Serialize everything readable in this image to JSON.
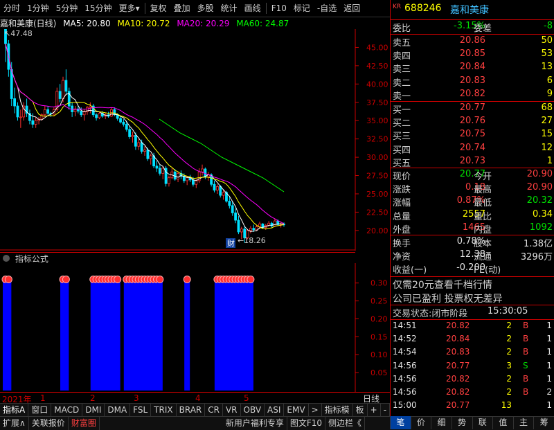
{
  "toolbar": {
    "items": [
      "分时",
      "1分钟",
      "5分钟",
      "15分钟",
      "更多▾",
      "复权",
      "叠加",
      "多股",
      "统计",
      "画线",
      "F10",
      "标记",
      "-自选",
      "返回"
    ]
  },
  "chart_header": {
    "name": "嘉和美康(日线)",
    "ma5": "MA5: 20.80",
    "ma10": "MA10: 20.72",
    "ma20": "MA20: 20.29",
    "ma60": "MA60: 24.87",
    "high_label": "47.48",
    "low_label": "18.26",
    "cai_label": "财"
  },
  "colors": {
    "ma5": "#ffffff",
    "ma10": "#ffff00",
    "ma20": "#ff00ff",
    "ma60": "#00ff00",
    "axis": "#cc0000"
  },
  "indicator": {
    "title": "指标公式"
  },
  "chart_data": [
    {
      "type": "candlestick",
      "title": "嘉和美康(日线)",
      "y_ticks": [
        45.0,
        42.5,
        40.0,
        37.5,
        35.0,
        32.5,
        30.0,
        27.5,
        25.0,
        22.5,
        20.0
      ],
      "ylim": [
        18.0,
        47.5
      ],
      "series": [
        {
          "name": "MA5",
          "values": []
        },
        {
          "name": "MA10",
          "values": []
        },
        {
          "name": "MA20",
          "values": []
        },
        {
          "name": "MA60",
          "values": []
        }
      ],
      "ohlc": [
        [
          47.5,
          47.5,
          43.0,
          45.5
        ],
        [
          45.5,
          46.0,
          41.0,
          42.0
        ],
        [
          42.0,
          43.0,
          37.0,
          38.0
        ],
        [
          38.0,
          39.5,
          36.0,
          37.0
        ],
        [
          37.0,
          37.5,
          35.0,
          35.5
        ],
        [
          35.5,
          36.5,
          34.0,
          35.5
        ],
        [
          35.5,
          37.5,
          35.0,
          37.0
        ],
        [
          37.0,
          38.0,
          35.5,
          36.0
        ],
        [
          36.0,
          36.5,
          34.5,
          35.0
        ],
        [
          35.0,
          36.0,
          34.0,
          34.5
        ],
        [
          34.5,
          35.5,
          34.0,
          35.0
        ],
        [
          35.0,
          35.5,
          34.5,
          35.2
        ],
        [
          35.2,
          36.0,
          35.0,
          35.8
        ],
        [
          35.8,
          37.0,
          35.5,
          36.5
        ],
        [
          36.5,
          37.0,
          35.8,
          36.0
        ],
        [
          36.0,
          36.2,
          35.5,
          35.9
        ],
        [
          35.9,
          36.8,
          35.7,
          36.5
        ],
        [
          36.5,
          39.5,
          36.2,
          39.0
        ],
        [
          39.0,
          40.0,
          37.5,
          38.0
        ],
        [
          38.0,
          41.0,
          37.5,
          40.5
        ],
        [
          40.5,
          42.0,
          38.5,
          39.0
        ],
        [
          39.0,
          39.5,
          36.5,
          37.0
        ],
        [
          37.0,
          37.5,
          35.5,
          36.2
        ],
        [
          36.2,
          37.0,
          35.6,
          36.6
        ],
        [
          36.6,
          37.0,
          36.0,
          36.3
        ],
        [
          36.3,
          36.8,
          35.5,
          35.8
        ],
        [
          35.8,
          36.5,
          35.0,
          36.2
        ],
        [
          36.2,
          37.0,
          35.8,
          36.8
        ],
        [
          36.8,
          37.5,
          36.0,
          37.0
        ],
        [
          37.0,
          37.3,
          35.5,
          35.8
        ],
        [
          35.8,
          36.0,
          35.0,
          35.4
        ],
        [
          35.4,
          36.2,
          35.2,
          36.0
        ],
        [
          36.0,
          36.3,
          35.4,
          35.6
        ],
        [
          35.6,
          36.0,
          35.2,
          35.8
        ],
        [
          35.8,
          36.2,
          35.4,
          35.6
        ],
        [
          35.6,
          36.8,
          35.5,
          36.5
        ],
        [
          36.5,
          36.8,
          35.6,
          35.8
        ],
        [
          35.8,
          36.0,
          35.0,
          35.3
        ],
        [
          35.3,
          35.6,
          34.6,
          34.8
        ],
        [
          34.8,
          35.2,
          34.2,
          34.5
        ],
        [
          34.5,
          35.0,
          33.5,
          33.8
        ],
        [
          33.8,
          34.2,
          32.5,
          32.8
        ],
        [
          32.8,
          33.5,
          32.0,
          33.0
        ],
        [
          33.0,
          33.4,
          31.0,
          31.5
        ],
        [
          31.5,
          32.5,
          31.0,
          32.0
        ],
        [
          32.0,
          32.4,
          30.5,
          30.8
        ],
        [
          30.8,
          31.5,
          30.2,
          31.0
        ],
        [
          31.0,
          31.3,
          29.5,
          29.8
        ],
        [
          29.8,
          30.5,
          29.0,
          30.2
        ],
        [
          30.2,
          30.6,
          28.5,
          28.8
        ],
        [
          28.8,
          29.5,
          28.0,
          28.5
        ],
        [
          28.5,
          29.0,
          27.5,
          27.8
        ],
        [
          27.8,
          28.8,
          27.0,
          28.5
        ],
        [
          28.5,
          28.8,
          26.0,
          26.4
        ],
        [
          26.4,
          27.5,
          26.0,
          27.2
        ],
        [
          27.2,
          28.5,
          27.0,
          28.0
        ],
        [
          28.0,
          28.4,
          26.8,
          27.0
        ],
        [
          27.0,
          28.0,
          26.6,
          27.8
        ],
        [
          27.8,
          28.2,
          27.0,
          27.4
        ],
        [
          27.4,
          27.8,
          26.5,
          26.8
        ],
        [
          26.8,
          27.4,
          26.2,
          27.2
        ],
        [
          27.2,
          27.6,
          26.6,
          26.9
        ],
        [
          26.9,
          27.3,
          26.0,
          26.3
        ],
        [
          26.3,
          27.0,
          25.8,
          26.8
        ],
        [
          26.8,
          28.5,
          26.5,
          28.0
        ],
        [
          28.0,
          29.0,
          27.5,
          28.4
        ],
        [
          28.4,
          28.6,
          27.0,
          27.3
        ],
        [
          27.3,
          28.0,
          26.8,
          27.6
        ],
        [
          27.6,
          27.8,
          26.0,
          26.3
        ],
        [
          26.3,
          26.8,
          25.2,
          25.5
        ],
        [
          25.5,
          26.3,
          25.0,
          26.0
        ],
        [
          26.0,
          26.2,
          24.5,
          24.8
        ],
        [
          24.8,
          25.5,
          24.2,
          25.2
        ],
        [
          25.2,
          25.4,
          23.8,
          24.0
        ],
        [
          24.0,
          24.6,
          23.0,
          23.4
        ],
        [
          23.4,
          24.0,
          22.0,
          22.4
        ],
        [
          22.4,
          23.0,
          21.0,
          21.4
        ],
        [
          21.4,
          22.0,
          19.5,
          19.8
        ],
        [
          19.8,
          20.5,
          18.8,
          20.2
        ],
        [
          20.2,
          20.6,
          18.3,
          19.0
        ],
        [
          19.0,
          20.2,
          18.8,
          20.0
        ],
        [
          20.0,
          20.6,
          19.6,
          20.3
        ],
        [
          20.3,
          20.8,
          19.8,
          20.1
        ],
        [
          20.1,
          20.7,
          19.9,
          20.5
        ],
        [
          20.5,
          21.2,
          20.2,
          20.9
        ],
        [
          20.9,
          21.0,
          20.2,
          20.4
        ],
        [
          20.4,
          20.9,
          20.1,
          20.7
        ],
        [
          20.7,
          21.3,
          20.5,
          21.0
        ],
        [
          21.0,
          21.2,
          20.4,
          20.6
        ],
        [
          20.6,
          21.6,
          20.5,
          21.3
        ],
        [
          21.3,
          21.5,
          20.6,
          20.8
        ],
        [
          20.8,
          21.2,
          20.4,
          20.9
        ],
        [
          20.9,
          21.1,
          20.5,
          20.77
        ]
      ]
    },
    {
      "type": "bar",
      "title": "指标公式",
      "y_ticks": [
        0.3,
        0.25,
        0.2,
        0.15,
        0.1,
        0.05
      ],
      "ylim": [
        0,
        0.34
      ],
      "x": [
        0,
        1,
        19,
        20,
        29,
        30,
        31,
        32,
        33,
        34,
        35,
        36,
        37,
        40,
        41,
        42,
        43,
        44,
        45,
        46,
        47,
        48,
        49,
        50,
        51,
        60,
        70,
        71,
        72,
        73,
        74,
        75,
        76,
        77,
        78,
        79,
        80,
        81
      ]
    }
  ],
  "time_axis": {
    "labels": [
      "2021年",
      "1",
      "2",
      "3",
      "4",
      "5"
    ],
    "right_label": "日线"
  },
  "bottom_tabs": [
    "指标A",
    "窗口",
    "MACD",
    "DMI",
    "DMA",
    "FSL",
    "TRIX",
    "BRAR",
    "CR",
    "VR",
    "OBV",
    "ASI",
    "EMV",
    ">",
    "指标模",
    "板",
    "+",
    "-"
  ],
  "bottom_bar": [
    "扩展∧",
    "关联报价",
    "财富圈",
    "新用户福利专享",
    "图文F10",
    "侧边栏《"
  ],
  "quote": {
    "badge": "KR",
    "code": "688246",
    "name": "嘉和美康",
    "weibi_label": "委比",
    "weibi": "-3.15%",
    "weicha_label": "委差",
    "weicha": "-8",
    "asks": [
      {
        "label": "卖五",
        "price": "20.86",
        "vol": "50"
      },
      {
        "label": "卖四",
        "price": "20.85",
        "vol": "53"
      },
      {
        "label": "卖三",
        "price": "20.84",
        "vol": "13"
      },
      {
        "label": "卖二",
        "price": "20.83",
        "vol": "6"
      },
      {
        "label": "卖一",
        "price": "20.82",
        "vol": "9"
      }
    ],
    "bids": [
      {
        "label": "买一",
        "price": "20.77",
        "vol": "68"
      },
      {
        "label": "买二",
        "price": "20.76",
        "vol": "27"
      },
      {
        "label": "买三",
        "price": "20.75",
        "vol": "15"
      },
      {
        "label": "买四",
        "price": "20.74",
        "vol": "12"
      },
      {
        "label": "买五",
        "price": "20.73",
        "vol": "1"
      }
    ],
    "stats": [
      {
        "l1": "现价",
        "v1": "20.77",
        "c1": "green",
        "l2": "今开",
        "v2": "20.90",
        "c2": "red"
      },
      {
        "l1": "涨跌",
        "v1": "0.18",
        "c1": "red",
        "l2": "最高",
        "v2": "20.90",
        "c2": "red"
      },
      {
        "l1": "涨幅",
        "v1": "0.87%",
        "c1": "red",
        "l2": "最低",
        "v2": "20.32",
        "c2": "green"
      },
      {
        "l1": "总量",
        "v1": "2557",
        "c1": "yellow",
        "l2": "量比",
        "v2": "0.34",
        "c2": "yellow"
      },
      {
        "l1": "外盘",
        "v1": "1465",
        "c1": "red",
        "l2": "内盘",
        "v2": "1092",
        "c2": "green"
      }
    ],
    "stats2": [
      {
        "l1": "换手",
        "v1": "0.78%",
        "l2": "股本",
        "v2": "1.38亿"
      },
      {
        "l1": "净资",
        "v1": "12.38",
        "l2": "流通",
        "v2": "3296万"
      },
      {
        "l1": "收益(一)",
        "v1": "-0.200",
        "l2": "PE(动)",
        "v2": ""
      }
    ],
    "promo1": "仅需20元查看千档行情",
    "promo2": "公司已盈利 投票权无差异",
    "trade_status_label": "交易状态:闭市阶段",
    "trade_status_time": "15:30:05",
    "ticks": [
      {
        "t": "14:51",
        "p": "20.82",
        "pc": "red",
        "v": "2",
        "s": "B",
        "sc": "red",
        "n": "1"
      },
      {
        "t": "14:52",
        "p": "20.84",
        "pc": "red",
        "v": "2",
        "s": "B",
        "sc": "red",
        "n": "1"
      },
      {
        "t": "14:54",
        "p": "20.83",
        "pc": "red",
        "v": "2",
        "s": "B",
        "sc": "red",
        "n": "1"
      },
      {
        "t": "14:56",
        "p": "20.77",
        "pc": "red",
        "v": "3",
        "s": "S",
        "sc": "green",
        "n": "1"
      },
      {
        "t": "14:56",
        "p": "20.82",
        "pc": "red",
        "v": "2",
        "s": "B",
        "sc": "red",
        "n": "1"
      },
      {
        "t": "14:56",
        "p": "20.82",
        "pc": "red",
        "v": "2",
        "s": "B",
        "sc": "red",
        "n": "2"
      },
      {
        "t": "15:00",
        "p": "20.77",
        "pc": "red",
        "v": "13",
        "s": "",
        "sc": "red",
        "n": "1"
      }
    ]
  },
  "right_tabs": [
    "笔",
    "价",
    "细",
    "势",
    "联",
    "值",
    "主",
    "筹"
  ]
}
